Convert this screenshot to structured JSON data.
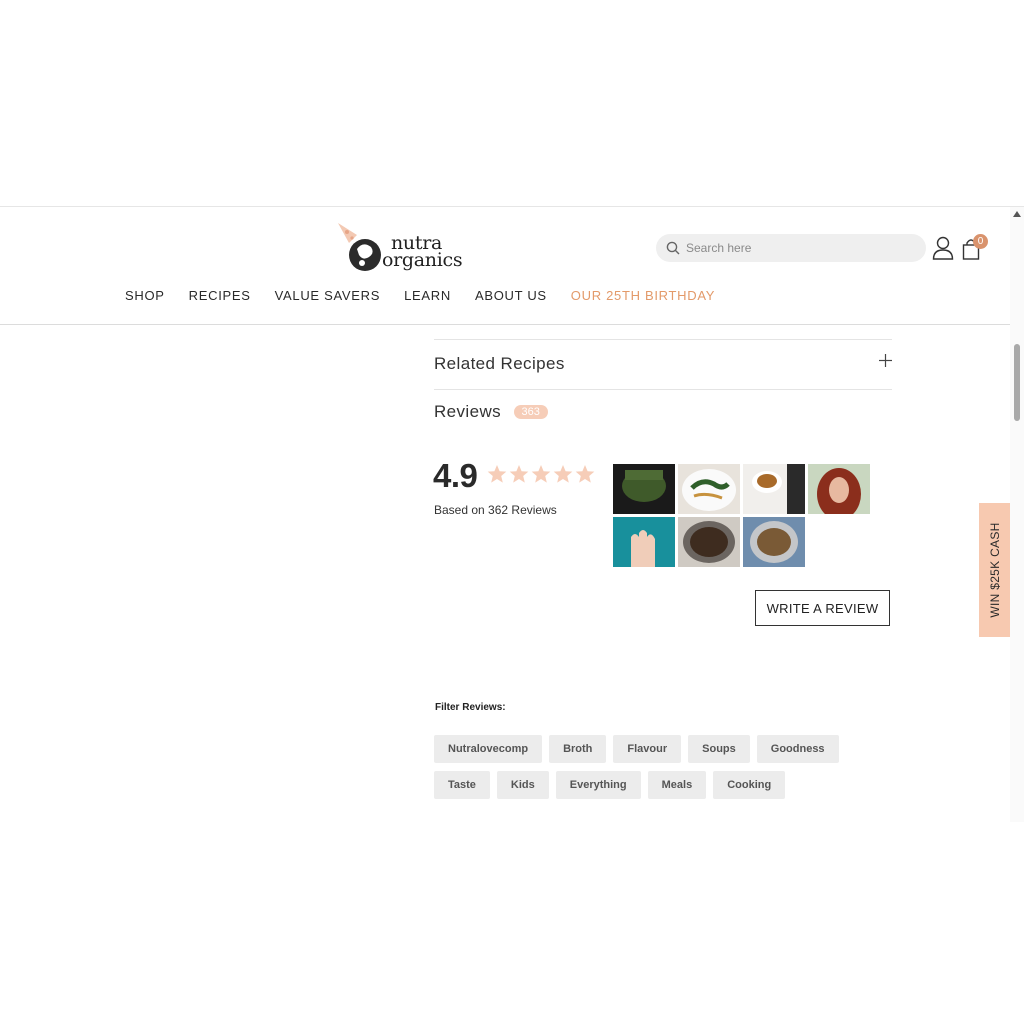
{
  "header": {
    "logo_line1": "nutra",
    "logo_line2": "organics",
    "search_placeholder": "Search here",
    "cart_count": "0",
    "nav": [
      "SHOP",
      "RECIPES",
      "VALUE SAVERS",
      "LEARN",
      "ABOUT US",
      "OUR 25TH BIRTHDAY"
    ],
    "accent_color": "#e39a6a"
  },
  "accordion": {
    "related_title": "Related Recipes"
  },
  "reviews": {
    "title": "Reviews",
    "count_badge": "363",
    "rating": "4.9",
    "stars": 5,
    "based_on": "Based on 362 Reviews",
    "write_button": "WRITE A REVIEW",
    "filter_label": "Filter Reviews:",
    "filters": [
      "Nutralovecomp",
      "Broth",
      "Flavour",
      "Soups",
      "Goodness",
      "Taste",
      "Kids",
      "Everything",
      "Meals",
      "Cooking"
    ],
    "photo_count": 7
  },
  "side_tab": {
    "label": "WIN $25K CASH",
    "color": "#f7c9b0"
  }
}
